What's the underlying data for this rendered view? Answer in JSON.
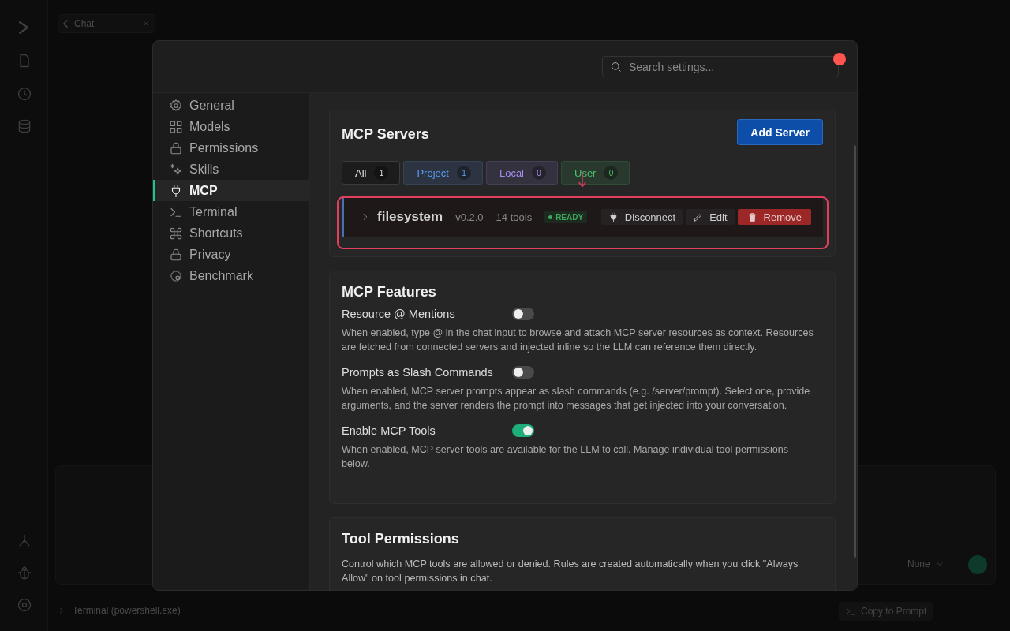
{
  "app": {
    "tab_title": "Chat",
    "model_picker": "None",
    "terminal_title": "Terminal (powershell.exe)",
    "copy_button": "Copy to Prompt"
  },
  "settings": {
    "search": {
      "placeholder": "Search settings..."
    },
    "nav": [
      {
        "label": "General",
        "selected": false
      },
      {
        "label": "Models",
        "selected": false
      },
      {
        "label": "Permissions",
        "selected": false
      },
      {
        "label": "Skills",
        "selected": false
      },
      {
        "label": "MCP",
        "selected": true
      },
      {
        "label": "Terminal",
        "selected": false
      },
      {
        "label": "Shortcuts",
        "selected": false
      },
      {
        "label": "Privacy",
        "selected": false
      },
      {
        "label": "Benchmark",
        "selected": false
      }
    ],
    "servers": {
      "title": "MCP Servers",
      "add_button": "Add Server",
      "filters": [
        {
          "label": "All",
          "count": "1",
          "color": "#e6e6e6",
          "selected": true
        },
        {
          "label": "Project",
          "count": "1",
          "color": "#5b9cf5",
          "selected": false
        },
        {
          "label": "Local",
          "count": "0",
          "color": "#a68bf0",
          "selected": false
        },
        {
          "label": "User",
          "count": "0",
          "color": "#4cc26e",
          "selected": false
        }
      ],
      "items": [
        {
          "name": "filesystem",
          "version": "v0.2.0",
          "tools": "14 tools",
          "status": "READY",
          "expanded": false,
          "actions": [
            {
              "kind": "disconnect",
              "label": "Disconnect"
            },
            {
              "kind": "edit",
              "label": "Edit"
            },
            {
              "kind": "remove",
              "label": "Remove"
            }
          ]
        }
      ]
    },
    "features": {
      "title": "MCP Features",
      "toggles": [
        {
          "label": "Resource @ Mentions",
          "on": false,
          "description": "When enabled, type @ in the chat input to browse and attach MCP server resources as context. Resources are fetched from connected servers and injected inline so the LLM can reference them directly."
        },
        {
          "label": "Prompts as Slash Commands",
          "on": false,
          "description": "When enabled, MCP server prompts appear as slash commands (e.g. /server/prompt). Select one, provide arguments, and the server renders the prompt into messages that get injected into your conversation."
        },
        {
          "label": "Enable MCP Tools",
          "on": true,
          "description": "When enabled, MCP server tools are available for the LLM to call. Manage individual tool permissions below."
        }
      ]
    },
    "tool_permissions": {
      "title": "Tool Permissions",
      "description": "Control which MCP tools are allowed or denied. Rules are created automatically when you click \"Always Allow\" on tool permissions in chat."
    }
  }
}
